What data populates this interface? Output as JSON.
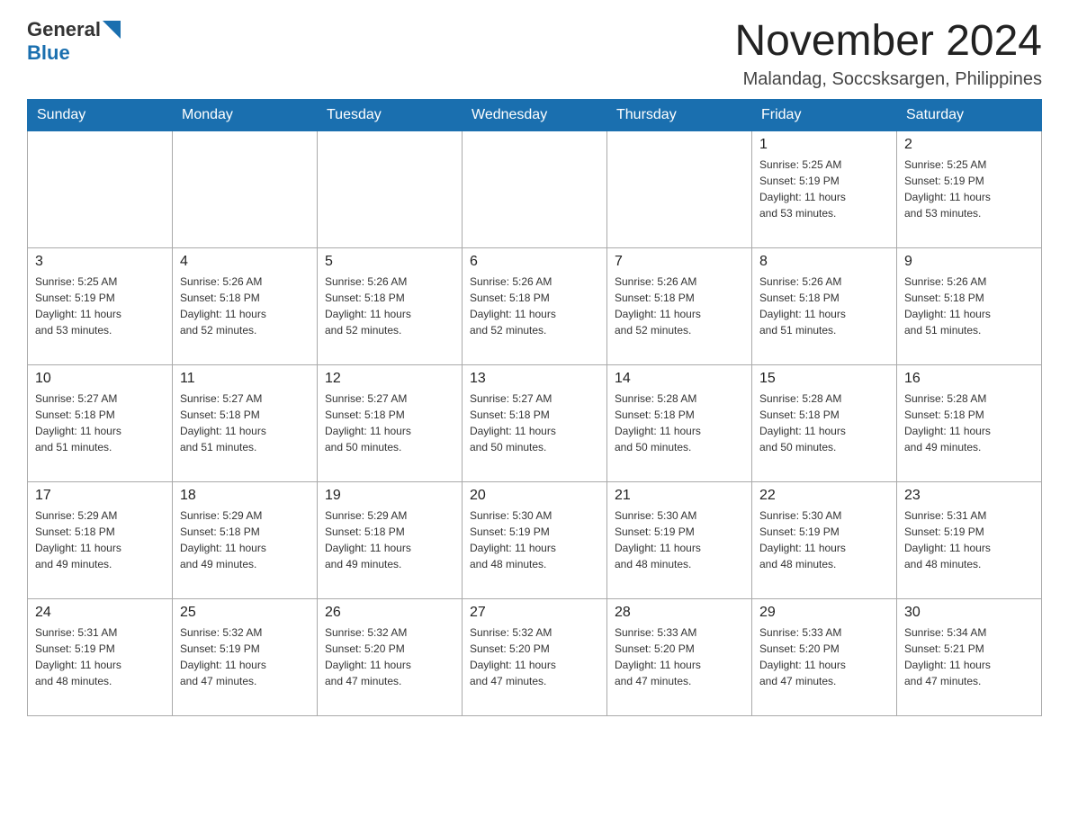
{
  "header": {
    "logo_general": "General",
    "logo_blue": "Blue",
    "month_title": "November 2024",
    "location": "Malandag, Soccsksargen, Philippines"
  },
  "weekdays": [
    "Sunday",
    "Monday",
    "Tuesday",
    "Wednesday",
    "Thursday",
    "Friday",
    "Saturday"
  ],
  "weeks": [
    [
      {
        "day": "",
        "info": ""
      },
      {
        "day": "",
        "info": ""
      },
      {
        "day": "",
        "info": ""
      },
      {
        "day": "",
        "info": ""
      },
      {
        "day": "",
        "info": ""
      },
      {
        "day": "1",
        "info": "Sunrise: 5:25 AM\nSunset: 5:19 PM\nDaylight: 11 hours\nand 53 minutes."
      },
      {
        "day": "2",
        "info": "Sunrise: 5:25 AM\nSunset: 5:19 PM\nDaylight: 11 hours\nand 53 minutes."
      }
    ],
    [
      {
        "day": "3",
        "info": "Sunrise: 5:25 AM\nSunset: 5:19 PM\nDaylight: 11 hours\nand 53 minutes."
      },
      {
        "day": "4",
        "info": "Sunrise: 5:26 AM\nSunset: 5:18 PM\nDaylight: 11 hours\nand 52 minutes."
      },
      {
        "day": "5",
        "info": "Sunrise: 5:26 AM\nSunset: 5:18 PM\nDaylight: 11 hours\nand 52 minutes."
      },
      {
        "day": "6",
        "info": "Sunrise: 5:26 AM\nSunset: 5:18 PM\nDaylight: 11 hours\nand 52 minutes."
      },
      {
        "day": "7",
        "info": "Sunrise: 5:26 AM\nSunset: 5:18 PM\nDaylight: 11 hours\nand 52 minutes."
      },
      {
        "day": "8",
        "info": "Sunrise: 5:26 AM\nSunset: 5:18 PM\nDaylight: 11 hours\nand 51 minutes."
      },
      {
        "day": "9",
        "info": "Sunrise: 5:26 AM\nSunset: 5:18 PM\nDaylight: 11 hours\nand 51 minutes."
      }
    ],
    [
      {
        "day": "10",
        "info": "Sunrise: 5:27 AM\nSunset: 5:18 PM\nDaylight: 11 hours\nand 51 minutes."
      },
      {
        "day": "11",
        "info": "Sunrise: 5:27 AM\nSunset: 5:18 PM\nDaylight: 11 hours\nand 51 minutes."
      },
      {
        "day": "12",
        "info": "Sunrise: 5:27 AM\nSunset: 5:18 PM\nDaylight: 11 hours\nand 50 minutes."
      },
      {
        "day": "13",
        "info": "Sunrise: 5:27 AM\nSunset: 5:18 PM\nDaylight: 11 hours\nand 50 minutes."
      },
      {
        "day": "14",
        "info": "Sunrise: 5:28 AM\nSunset: 5:18 PM\nDaylight: 11 hours\nand 50 minutes."
      },
      {
        "day": "15",
        "info": "Sunrise: 5:28 AM\nSunset: 5:18 PM\nDaylight: 11 hours\nand 50 minutes."
      },
      {
        "day": "16",
        "info": "Sunrise: 5:28 AM\nSunset: 5:18 PM\nDaylight: 11 hours\nand 49 minutes."
      }
    ],
    [
      {
        "day": "17",
        "info": "Sunrise: 5:29 AM\nSunset: 5:18 PM\nDaylight: 11 hours\nand 49 minutes."
      },
      {
        "day": "18",
        "info": "Sunrise: 5:29 AM\nSunset: 5:18 PM\nDaylight: 11 hours\nand 49 minutes."
      },
      {
        "day": "19",
        "info": "Sunrise: 5:29 AM\nSunset: 5:18 PM\nDaylight: 11 hours\nand 49 minutes."
      },
      {
        "day": "20",
        "info": "Sunrise: 5:30 AM\nSunset: 5:19 PM\nDaylight: 11 hours\nand 48 minutes."
      },
      {
        "day": "21",
        "info": "Sunrise: 5:30 AM\nSunset: 5:19 PM\nDaylight: 11 hours\nand 48 minutes."
      },
      {
        "day": "22",
        "info": "Sunrise: 5:30 AM\nSunset: 5:19 PM\nDaylight: 11 hours\nand 48 minutes."
      },
      {
        "day": "23",
        "info": "Sunrise: 5:31 AM\nSunset: 5:19 PM\nDaylight: 11 hours\nand 48 minutes."
      }
    ],
    [
      {
        "day": "24",
        "info": "Sunrise: 5:31 AM\nSunset: 5:19 PM\nDaylight: 11 hours\nand 48 minutes."
      },
      {
        "day": "25",
        "info": "Sunrise: 5:32 AM\nSunset: 5:19 PM\nDaylight: 11 hours\nand 47 minutes."
      },
      {
        "day": "26",
        "info": "Sunrise: 5:32 AM\nSunset: 5:20 PM\nDaylight: 11 hours\nand 47 minutes."
      },
      {
        "day": "27",
        "info": "Sunrise: 5:32 AM\nSunset: 5:20 PM\nDaylight: 11 hours\nand 47 minutes."
      },
      {
        "day": "28",
        "info": "Sunrise: 5:33 AM\nSunset: 5:20 PM\nDaylight: 11 hours\nand 47 minutes."
      },
      {
        "day": "29",
        "info": "Sunrise: 5:33 AM\nSunset: 5:20 PM\nDaylight: 11 hours\nand 47 minutes."
      },
      {
        "day": "30",
        "info": "Sunrise: 5:34 AM\nSunset: 5:21 PM\nDaylight: 11 hours\nand 47 minutes."
      }
    ]
  ]
}
